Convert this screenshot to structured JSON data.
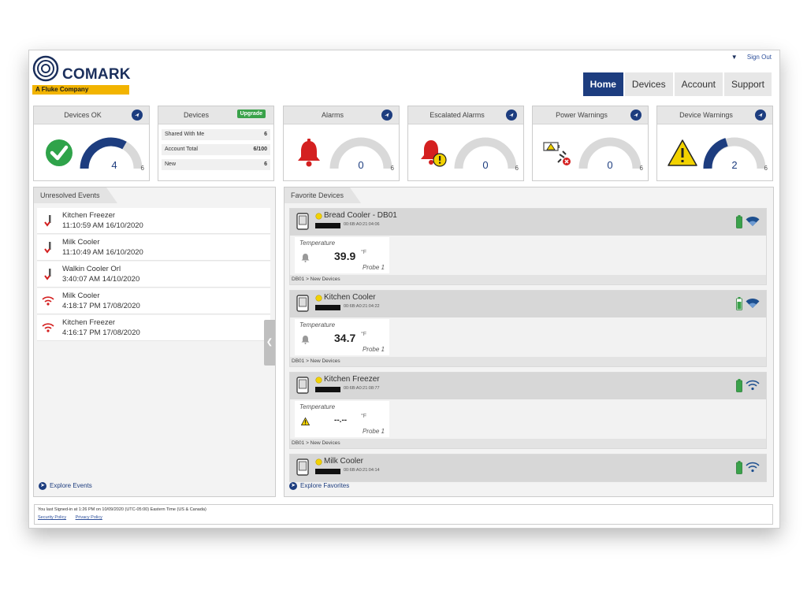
{
  "header": {
    "brand": "COMARK",
    "tagline": "A Fluke Company",
    "sign_out": "Sign Out",
    "nav": [
      "Home",
      "Devices",
      "Account",
      "Support"
    ],
    "active_tab": "Home"
  },
  "widgets": {
    "devices_ok": {
      "title": "Devices OK",
      "count": "4",
      "total": "6"
    },
    "devices": {
      "title": "Devices",
      "upgrade": "Upgrade",
      "rows": [
        {
          "label": "Shared With Me",
          "value": "6"
        },
        {
          "label": "Account Total",
          "value": "6/100"
        },
        {
          "label": "New",
          "value": "6"
        }
      ]
    },
    "alarms": {
      "title": "Alarms",
      "count": "0",
      "total": "6"
    },
    "escalated_alarms": {
      "title": "Escalated Alarms",
      "count": "0",
      "total": "6"
    },
    "power_warnings": {
      "title": "Power Warnings",
      "count": "0",
      "total": "6"
    },
    "device_warnings": {
      "title": "Device Warnings",
      "count": "2",
      "total": "6"
    }
  },
  "unresolved_events": {
    "title": "Unresolved Events",
    "items": [
      {
        "name": "Kitchen Freezer",
        "time": "11:10:59 AM  16/10/2020",
        "icon": "temperature-icon"
      },
      {
        "name": "Milk Cooler",
        "time": "11:10:49 AM  16/10/2020",
        "icon": "temperature-icon"
      },
      {
        "name": "Walkin Cooler Orl",
        "time": "3:40:07 AM  14/10/2020",
        "icon": "temperature-icon"
      },
      {
        "name": "Milk Cooler",
        "time": "4:18:17 PM  17/08/2020",
        "icon": "wifi-off-icon"
      },
      {
        "name": "Kitchen Freezer",
        "time": "4:16:17 PM  17/08/2020",
        "icon": "wifi-off-icon"
      }
    ],
    "explore": "Explore Events"
  },
  "favorite_devices": {
    "title": "Favorite Devices",
    "items": [
      {
        "name": "Bread Cooler - DB01",
        "serial": "00:6B:A0:21:04:06",
        "reading_label": "Temperature",
        "value": "39.9",
        "unit": "°F",
        "probe": "Probe 1",
        "path": "DB01 > New Devices"
      },
      {
        "name": "Kitchen Cooler",
        "serial": "00:6B:A0:21:04:22",
        "reading_label": "Temperature",
        "value": "34.7",
        "unit": "°F",
        "probe": "Probe 1",
        "path": "DB01 > New Devices"
      },
      {
        "name": "Kitchen Freezer",
        "serial": "00:6B:A0:21:08:77",
        "reading_label": "Temperature",
        "value": "--.--",
        "unit": "°F",
        "probe": "Probe 1",
        "path": "DB01 > New Devices"
      },
      {
        "name": "Milk Cooler",
        "serial": "00:6B:A0:21:04:14"
      }
    ],
    "explore": "Explore Favorites"
  },
  "footer": {
    "last_signed": "You last Signed-in at 1:26 PM on 10/09/2020 (UTC-05:00) Eastern Time (US & Canada)",
    "links": [
      "Security Policy",
      "Privacy Policy"
    ]
  },
  "colors": {
    "navy": "#1d3d7f",
    "green": "#2fa34a",
    "red": "#d42020",
    "yellow": "#f2d200",
    "gauge_track": "#d9d9d9"
  }
}
